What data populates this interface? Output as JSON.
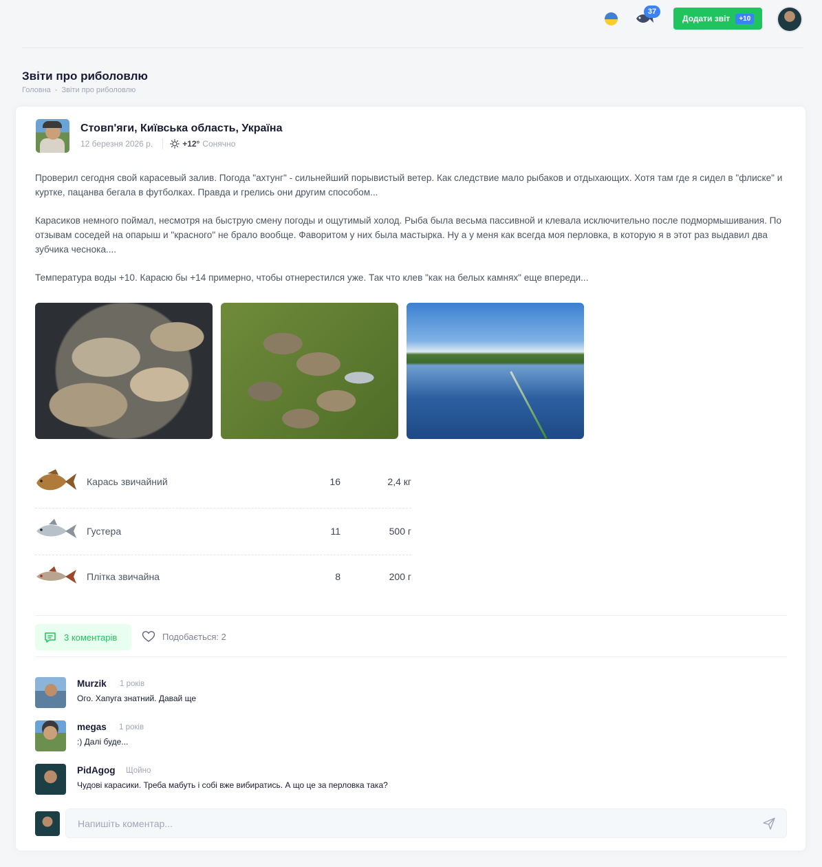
{
  "header": {
    "fish_badge_count": "37",
    "add_report_label": "Додати звіт",
    "add_report_bonus": "+10",
    "icons": [
      "ukraine-flag-icon",
      "fish-icon",
      "user-avatar"
    ]
  },
  "page": {
    "title": "Звіти про риболовлю",
    "breadcrumb": [
      "Головна",
      "-",
      "Звіти про риболовлю"
    ]
  },
  "post": {
    "location": "Стовп'яги, Київська область, Україна",
    "date": "12 березня 2026 р.",
    "temperature": "+12°",
    "weather": "Сонячно",
    "paragraphs": [
      "Проверил сегодня свой карасевый залив. Погода \"ахтунг\" - сильнейший порывистый ветер. Как следствие мало рыбаков и отдыхающих. Хотя там где я сидел в \"флиске\" и куртке, пацанва бегала в футболках. Правда и грелись они другим способом...",
      "Карасиков немного поймал, несмотря на быструю смену погоды и ощутимый холод. Рыба была весьма пассивной и клевала исключительно после подмормышивания. По отзывам соседей на опарыш и \"красного\" не брало вообще. Фаворитом у них была мастырка. Ну а у меня как всегда моя перловка, в которую я в этот раз выдавил два зубчика чеснока....",
      "Температура воды +10. Карасю бы +14 примерно, чтобы отнерестился уже. Так что клев \"как на белых камнях\" еще впереди..."
    ],
    "photos": [
      "catch-in-net-photo",
      "fish-on-grass-photo",
      "lake-photo"
    ],
    "catch": [
      {
        "name": "Карась звичайний",
        "count": "16",
        "weight": "2,4 кг"
      },
      {
        "name": "Густера",
        "count": "11",
        "weight": "500 г"
      },
      {
        "name": "Плітка звичайна",
        "count": "8",
        "weight": "200 г"
      }
    ],
    "comments_label": "3 коментарів",
    "likes_label": "Подобається: 2"
  },
  "comments": [
    {
      "author": "Murzik",
      "time": "1 років",
      "text": "Ого. Хапуга знатний. Давай ще"
    },
    {
      "author": "megas",
      "time": "1 років",
      "text": ":) Далі буде..."
    },
    {
      "author": "PidAgog",
      "time": "Щойно",
      "text": "Чудові карасики. Треба мабуть і собі вже вибиратись. А що це за перловка така?"
    }
  ],
  "comment_form": {
    "placeholder": "Напишіть коментар..."
  },
  "colors": {
    "accent_green": "#1fc45f",
    "badge_blue": "#3b82f6"
  }
}
